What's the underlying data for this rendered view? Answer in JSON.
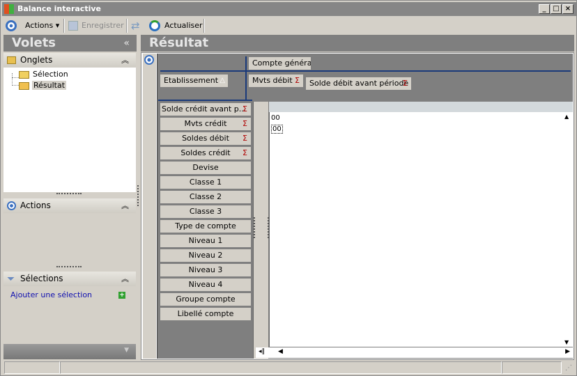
{
  "window": {
    "title": "Balance interactive",
    "min": "_",
    "max": "□",
    "close": "×"
  },
  "toolbar": {
    "actions": "Actions",
    "save": "Enregistrer",
    "refresh": "Actualiser"
  },
  "left": {
    "title": "Volets",
    "collapse": "«",
    "onglets": {
      "label": "Onglets",
      "items": [
        "Sélection",
        "Résultat"
      ]
    },
    "actions": {
      "label": "Actions"
    },
    "selections": {
      "label": "Sélections",
      "add_link": "Ajouter une sélection"
    }
  },
  "right": {
    "title": "Résultat",
    "column_fields": [
      "Compte général"
    ],
    "row_header_fields": [
      "Etablissement"
    ],
    "data_fields": [
      "Mvts débit",
      "Solde débit avant période"
    ],
    "row_fields": [
      {
        "label": "Solde crédit avant p...",
        "sum": true
      },
      {
        "label": "Mvts crédit",
        "sum": true
      },
      {
        "label": "Soldes débit",
        "sum": true
      },
      {
        "label": "Soldes crédit",
        "sum": true
      },
      {
        "label": "Devise",
        "sum": false
      },
      {
        "label": "Classe 1",
        "sum": false
      },
      {
        "label": "Classe 2",
        "sum": false
      },
      {
        "label": "Classe 3",
        "sum": false
      },
      {
        "label": "Type de compte",
        "sum": false
      },
      {
        "label": "Niveau 1",
        "sum": false
      },
      {
        "label": "Niveau 2",
        "sum": false
      },
      {
        "label": "Niveau 3",
        "sum": false
      },
      {
        "label": "Niveau 4",
        "sum": false
      },
      {
        "label": "Groupe compte",
        "sum": false
      },
      {
        "label": "Libellé compte",
        "sum": false
      }
    ],
    "sigma": "Σ",
    "cells": [
      "00",
      "00"
    ]
  }
}
